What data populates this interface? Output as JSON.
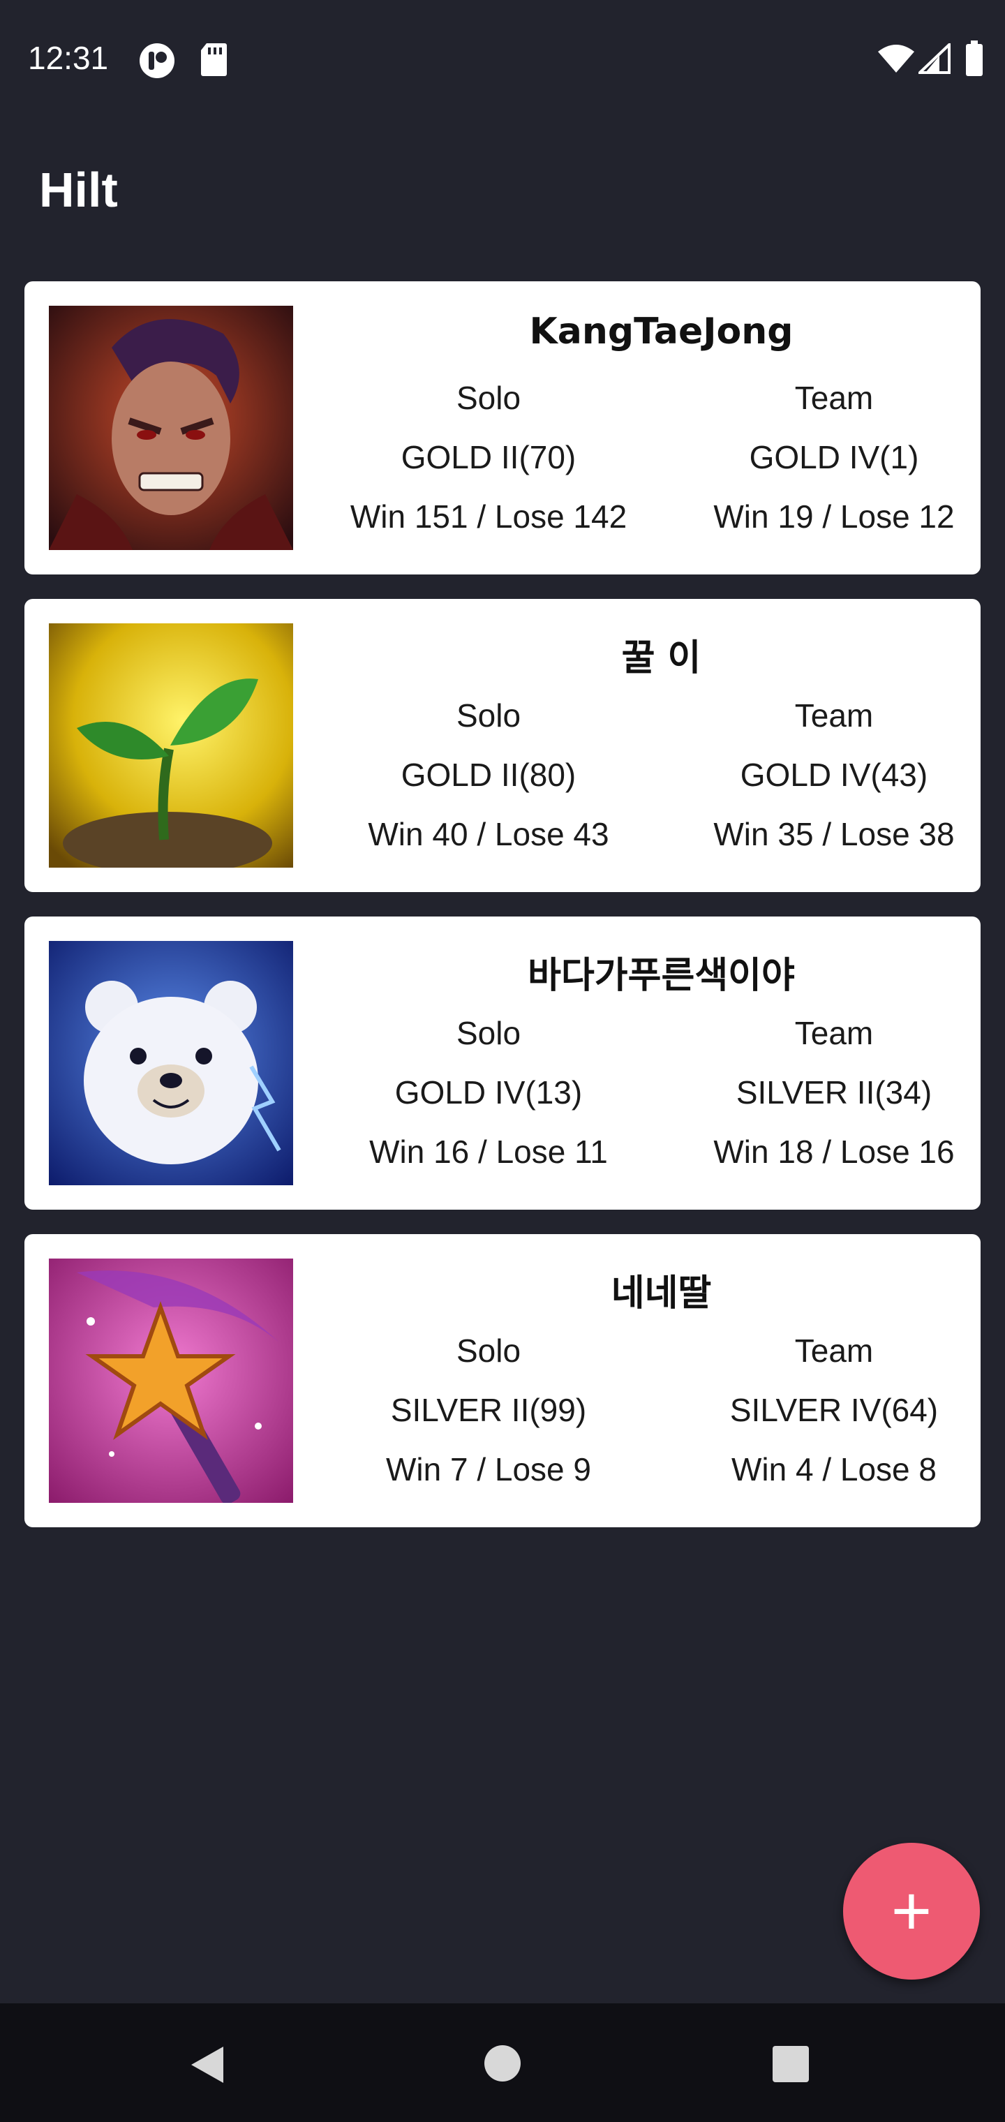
{
  "status_bar": {
    "time": "12:31",
    "icons": [
      "media-app-icon",
      "sd-card-icon",
      "wifi-icon",
      "signal-icon",
      "battery-icon"
    ]
  },
  "app": {
    "title": "Hilt"
  },
  "cards": [
    {
      "name": "KangTaeJong",
      "avatar": "warrior-champion-icon",
      "solo": {
        "label": "Solo",
        "rank": "GOLD II(70)",
        "record": "Win 151 / Lose 142"
      },
      "team": {
        "label": "Team",
        "rank": "GOLD IV(1)",
        "record": "Win 19 / Lose 12"
      }
    },
    {
      "name": "꿀 이",
      "avatar": "sprout-icon",
      "solo": {
        "label": "Solo",
        "rank": "GOLD II(80)",
        "record": "Win 40 / Lose 43"
      },
      "team": {
        "label": "Team",
        "rank": "GOLD IV(43)",
        "record": "Win 35 / Lose 38"
      }
    },
    {
      "name": "바다가푸른색이야",
      "avatar": "polar-bear-icon",
      "solo": {
        "label": "Solo",
        "rank": "GOLD IV(13)",
        "record": "Win 16 / Lose 11"
      },
      "team": {
        "label": "Team",
        "rank": "SILVER II(34)",
        "record": "Win 18 / Lose 16"
      }
    },
    {
      "name": "네네딸",
      "avatar": "star-wand-icon",
      "solo": {
        "label": "Solo",
        "rank": "SILVER II(99)",
        "record": "Win 7 / Lose 9"
      },
      "team": {
        "label": "Team",
        "rank": "SILVER IV(64)",
        "record": "Win 4 / Lose 8"
      }
    }
  ],
  "fab": {
    "label": "+",
    "icon": "add-icon",
    "color": "#ee5a72"
  },
  "nav_bar": {
    "buttons": [
      "back-icon",
      "home-icon",
      "recents-icon"
    ]
  },
  "colors": {
    "background": "#22232d",
    "card": "#ffffff",
    "nav_bar": "#0f0f14"
  }
}
